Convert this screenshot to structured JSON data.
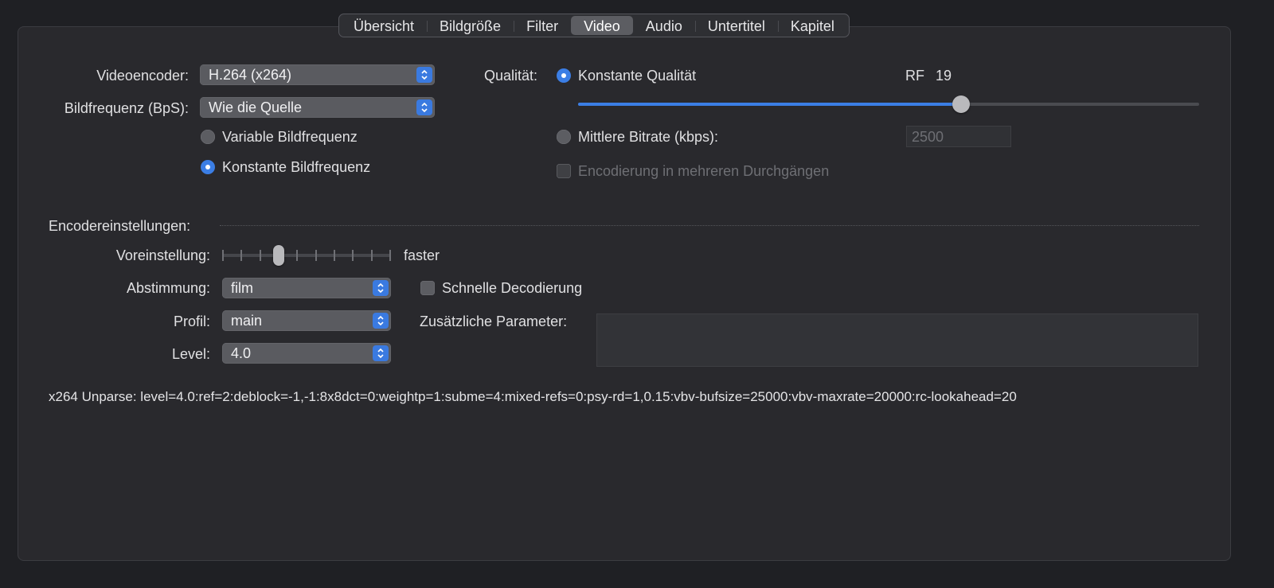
{
  "tabs": [
    {
      "label": "Übersicht",
      "active": false
    },
    {
      "label": "Bildgröße",
      "active": false
    },
    {
      "label": "Filter",
      "active": false
    },
    {
      "label": "Video",
      "active": true
    },
    {
      "label": "Audio",
      "active": false
    },
    {
      "label": "Untertitel",
      "active": false
    },
    {
      "label": "Kapitel",
      "active": false
    }
  ],
  "video": {
    "encoder_label": "Videoencoder:",
    "encoder_value": "H.264 (x264)",
    "framerate_label": "Bildfrequenz (BpS):",
    "framerate_value": "Wie die Quelle",
    "variable_framerate": "Variable Bildfrequenz",
    "constant_framerate": "Konstante Bildfrequenz",
    "selected_framerate_mode": "constant"
  },
  "quality": {
    "label": "Qualität:",
    "constant_quality": "Konstante Qualität",
    "rf_label": "RF",
    "rf_value": "19",
    "slider_fraction": 0.62,
    "avg_bitrate": "Mittlere Bitrate (kbps):",
    "bitrate_value": "2500",
    "multipass": "Encodierung in mehreren Durchgängen"
  },
  "encoder_settings": {
    "heading": "Encodereinstellungen:",
    "preset_label": "Voreinstellung:",
    "preset_value": "faster",
    "preset_index": 3,
    "preset_steps": 10,
    "tune_label": "Abstimmung:",
    "tune_value": "film",
    "fast_decode": "Schnelle Decodierung",
    "profile_label": "Profil:",
    "profile_value": "main",
    "level_label": "Level:",
    "level_value": "4.0",
    "extra_params": "Zusätzliche Parameter:"
  },
  "unparse": "x264 Unparse: level=4.0:ref=2:deblock=-1,-1:8x8dct=0:weightp=1:subme=4:mixed-refs=0:psy-rd=1,0.15:vbv-bufsize=25000:vbv-maxrate=20000:rc-lookahead=20",
  "colors": {
    "accent": "#3b7ee5",
    "background": "#29292d"
  }
}
